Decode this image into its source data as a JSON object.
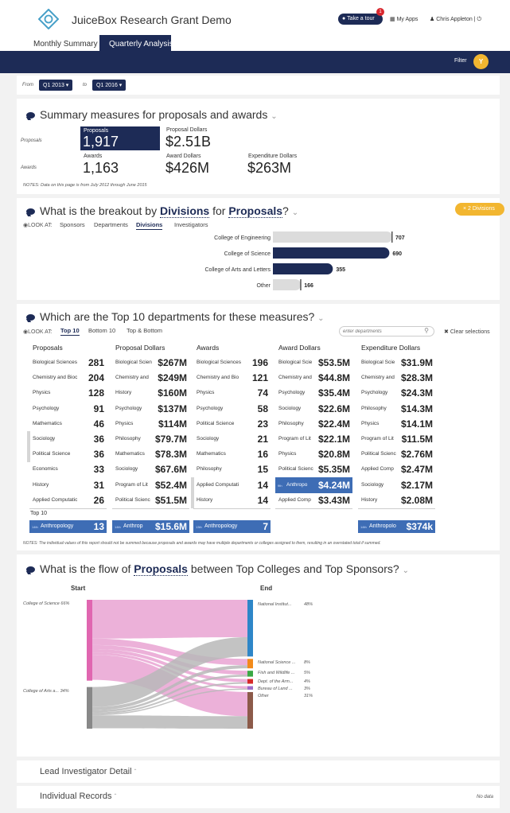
{
  "header": {
    "app_title": "JuiceBox Research Grant Demo",
    "tour_label": "Take a tour",
    "tour_badge": "1",
    "my_apps": "My Apps",
    "user": "Chris Appleton |"
  },
  "tabs": [
    {
      "label": "Monthly Summary",
      "active": false
    },
    {
      "label": "Quarterly Analysis",
      "active": true
    }
  ],
  "navbar": {
    "filter_label": "Filter"
  },
  "date_range": {
    "from_label": "From",
    "from_value": "Q1 2013",
    "to_label": "to",
    "to_value": "Q1 2016"
  },
  "summary": {
    "title": "Summary measures for proposals and awards",
    "row_proposals": "Proposals",
    "row_awards": "Awards",
    "proposals_label": "Proposals",
    "proposals_value": "1,917",
    "proposal_dollars_label": "Proposal Dollars",
    "proposal_dollars_value": "$2.51B",
    "awards_label": "Awards",
    "awards_value": "1,163",
    "award_dollars_label": "Award Dollars",
    "award_dollars_value": "$426M",
    "expenditure_label": "Expenditure Dollars",
    "expenditure_value": "$263M",
    "notes": "NOTES: Data on this page is from July 2012 through June 2015"
  },
  "breakout": {
    "title_pre": "What is the breakout by",
    "title_dim": "Divisions",
    "title_mid": "for",
    "title_measure": "Proposals",
    "title_q": "?",
    "badge": "2 Divisions",
    "look_at": "LOOK AT:",
    "options": [
      "Sponsors",
      "Departments",
      "Divisions",
      "Investigators"
    ],
    "selected": "Divisions",
    "bars": [
      {
        "label": "College of Engineering",
        "value": 707,
        "color": "#dcdcdc"
      },
      {
        "label": "College of Science",
        "value": 690,
        "color": "#1d2b56"
      },
      {
        "label": "College of Arts and Letters",
        "value": 355,
        "color": "#1d2b56"
      },
      {
        "label": "Other",
        "value": 166,
        "color": "#dcdcdc"
      }
    ]
  },
  "top10": {
    "title": "Which are the Top 10 departments for these measures?",
    "look_at": "LOOK AT:",
    "options": [
      "Top 10",
      "Bottom 10",
      "Top & Bottom"
    ],
    "selected": "Top 10",
    "search_placeholder": "enter departments",
    "clear_label": "Clear selections",
    "top10_label": "Top 10",
    "columns": [
      {
        "header": "Proposals",
        "rows": [
          {
            "name": "Biological Sciences",
            "value": "281"
          },
          {
            "name": "Chemistry and Bioc",
            "value": "204"
          },
          {
            "name": "Physics",
            "value": "128"
          },
          {
            "name": "Psychology",
            "value": "91"
          },
          {
            "name": "Mathematics",
            "value": "46"
          },
          {
            "name": "Sociology",
            "value": "36",
            "mark": true
          },
          {
            "name": "Political Science",
            "value": "36",
            "mark": true
          },
          {
            "name": "Economics",
            "value": "33"
          },
          {
            "name": "History",
            "value": "31"
          },
          {
            "name": "Applied Computatio",
            "value": "26"
          }
        ]
      },
      {
        "header": "Proposal Dollars",
        "rows": [
          {
            "name": "Biological Scien",
            "value": "$267M"
          },
          {
            "name": "Chemistry and",
            "value": "$249M"
          },
          {
            "name": "History",
            "value": "$160M"
          },
          {
            "name": "Psychology",
            "value": "$137M"
          },
          {
            "name": "Physics",
            "value": "$114M"
          },
          {
            "name": "Philosophy",
            "value": "$79.7M"
          },
          {
            "name": "Mathematics",
            "value": "$78.3M"
          },
          {
            "name": "Sociology",
            "value": "$67.6M"
          },
          {
            "name": "Program of Lit",
            "value": "$52.4M"
          },
          {
            "name": "Political Scienc",
            "value": "$51.5M"
          }
        ]
      },
      {
        "header": "Awards",
        "rows": [
          {
            "name": "Biological Sciences",
            "value": "196"
          },
          {
            "name": "Chemistry and Bio",
            "value": "121"
          },
          {
            "name": "Physics",
            "value": "74"
          },
          {
            "name": "Psychology",
            "value": "58"
          },
          {
            "name": "Political Science",
            "value": "23"
          },
          {
            "name": "Sociology",
            "value": "21"
          },
          {
            "name": "Mathematics",
            "value": "16"
          },
          {
            "name": "Philosophy",
            "value": "15"
          },
          {
            "name": "Applied Computati",
            "value": "14",
            "mark": true
          },
          {
            "name": "History",
            "value": "14",
            "mark": true
          }
        ]
      },
      {
        "header": "Award Dollars",
        "rows": [
          {
            "name": "Biological Scie",
            "value": "$53.5M"
          },
          {
            "name": "Chemistry and",
            "value": "$44.8M"
          },
          {
            "name": "Psychology",
            "value": "$35.4M"
          },
          {
            "name": "Sociology",
            "value": "$22.6M"
          },
          {
            "name": "Philosophy",
            "value": "$22.4M"
          },
          {
            "name": "Program of Lit",
            "value": "$22.1M"
          },
          {
            "name": "Physics",
            "value": "$20.8M"
          },
          {
            "name": "Political Scienc",
            "value": "$5.35M"
          },
          {
            "name": "Anthropo",
            "value": "$4.24M",
            "selected": true,
            "rank": "9th"
          },
          {
            "name": "Applied Comp",
            "value": "$3.43M"
          }
        ]
      },
      {
        "header": "Expenditure Dollars",
        "rows": [
          {
            "name": "Biological Scie",
            "value": "$31.9M"
          },
          {
            "name": "Chemistry and",
            "value": "$28.3M"
          },
          {
            "name": "Psychology",
            "value": "$24.3M"
          },
          {
            "name": "Philosophy",
            "value": "$14.3M"
          },
          {
            "name": "Physics",
            "value": "$14.1M"
          },
          {
            "name": "Program of Lit",
            "value": "$11.5M"
          },
          {
            "name": "Political Scienc",
            "value": "$2.76M"
          },
          {
            "name": "Applied Comp",
            "value": "$2.47M"
          },
          {
            "name": "Sociology",
            "value": "$2.17M"
          },
          {
            "name": "History",
            "value": "$2.08M"
          }
        ]
      }
    ],
    "selected_row": [
      {
        "rank": "14th",
        "name": "Anthropology",
        "value": "13"
      },
      {
        "rank": "14th",
        "name": "Anthrop",
        "value": "$15.6M"
      },
      {
        "rank": "13th",
        "name": "Anthropology",
        "value": "7"
      },
      null,
      {
        "rank": "14th",
        "name": "Anthropolo",
        "value": "$374k"
      }
    ],
    "notes": "NOTES: The individual values of this report should not be summed because proposals and awards may have multiple departments or colleges assigned to them, resulting in an overstated total if summed."
  },
  "flow": {
    "title_pre": "What is the flow of",
    "title_measure": "Proposals",
    "title_post": "between Top Colleges and Top Sponsors?",
    "start_label": "Start",
    "end_label": "End",
    "sources": [
      {
        "label": "College of Science",
        "pct": "66%",
        "color": "#e066b0"
      },
      {
        "label": "College of Arts a...",
        "pct": "34%",
        "color": "#888888"
      }
    ],
    "targets": [
      {
        "label": "National Institut...",
        "pct": "48%",
        "color": "#2e86c8"
      },
      {
        "label": "National Science ...",
        "pct": "8%",
        "color": "#f28a1a"
      },
      {
        "label": "Fish and Wildlife ...",
        "pct": "5%",
        "color": "#3aa844"
      },
      {
        "label": "Dept. of the Arm...",
        "pct": "4%",
        "color": "#d62a2a"
      },
      {
        "label": "Bureau of Land ...",
        "pct": "3%",
        "color": "#9e6bc8"
      },
      {
        "label": "Other",
        "pct": "31%",
        "color": "#8c5a4a"
      }
    ]
  },
  "footer": {
    "lead_label": "Lead Investigator Detail",
    "records_label": "Individual Records",
    "no_data": "No data"
  }
}
